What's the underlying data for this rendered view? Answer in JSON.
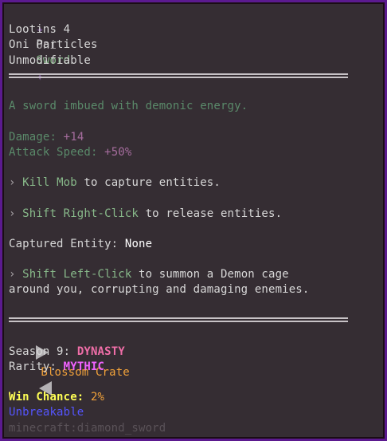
{
  "item": {
    "star_left": "✦",
    "name_prefix": "Oni",
    "name_main": "Sword",
    "star_right": "✦",
    "enchant": "Lootins 4",
    "particles": "Oni Particles",
    "modifiable": "Unmodifiable"
  },
  "description": "A sword imbued with demonic energy.",
  "stats": {
    "damage_label": "Damage:",
    "damage_value": "+14",
    "attack_speed_label": "Attack Speed:",
    "attack_speed_value": "+50%"
  },
  "abilities": {
    "kill_prefix": "› ",
    "kill_action": "Kill Mob",
    "kill_text": " to capture entities.",
    "release_prefix": "› ",
    "release_action": "Shift Right-Click",
    "release_text": " to release entities.",
    "captured_label": "Captured Entity:",
    "captured_value": "None",
    "summon_prefix": "› ",
    "summon_action": "Shift Left-Click",
    "summon_text": " to summon a Demon cage",
    "summon_text_2": "around you, corrupting and damaging enemies."
  },
  "crate": {
    "name": "Blossom Crate",
    "season_label": "Season 9:",
    "season_value": "DYNASTY",
    "rarity_label": "Rarity:",
    "rarity_value": "MYTHIC",
    "win_chance_label": "Win Chance:",
    "win_chance_value": "2%",
    "unbreakable": "Unbreakable",
    "item_id": "minecraft:diamond_sword"
  },
  "colors": {
    "background": "#352d33",
    "border": "#5b1a8f",
    "name": "#88b98a",
    "rarity": "#f062ff",
    "crate": "#f2a23a",
    "win_chance": "#ffff55",
    "unbreakable": "#5555ff"
  }
}
